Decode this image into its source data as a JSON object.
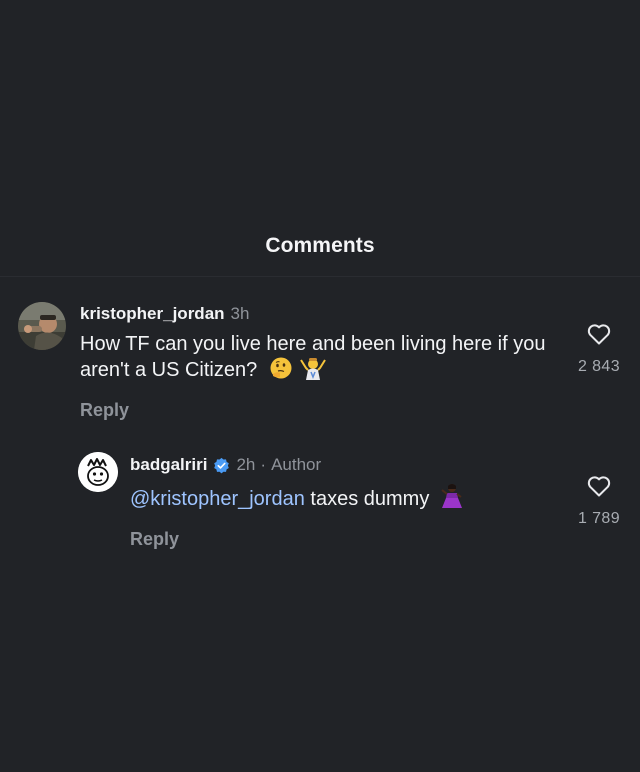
{
  "header": {
    "title": "Comments"
  },
  "comments": [
    {
      "username": "kristopher_jordan",
      "time": "3h",
      "text": "How TF can you live here and been living here if you aren't a US Citizen?",
      "emojis": [
        "thinking-face-emoji",
        "shrug-emoji"
      ],
      "reply_label": "Reply",
      "likes": "2 843"
    },
    {
      "username": "badgalriri",
      "verified": true,
      "time": "2h",
      "separator": "·",
      "author_label": "Author",
      "mention": "@kristopher_jordan",
      "text": " taxes dummy",
      "emojis": [
        "dancer-emoji"
      ],
      "reply_label": "Reply",
      "likes": "1 789"
    }
  ],
  "colors": {
    "background": "#212327",
    "text": "#f3f4f6",
    "muted": "#8f939a",
    "mention": "#9ec4ff",
    "verified": "#4a9bf5"
  }
}
